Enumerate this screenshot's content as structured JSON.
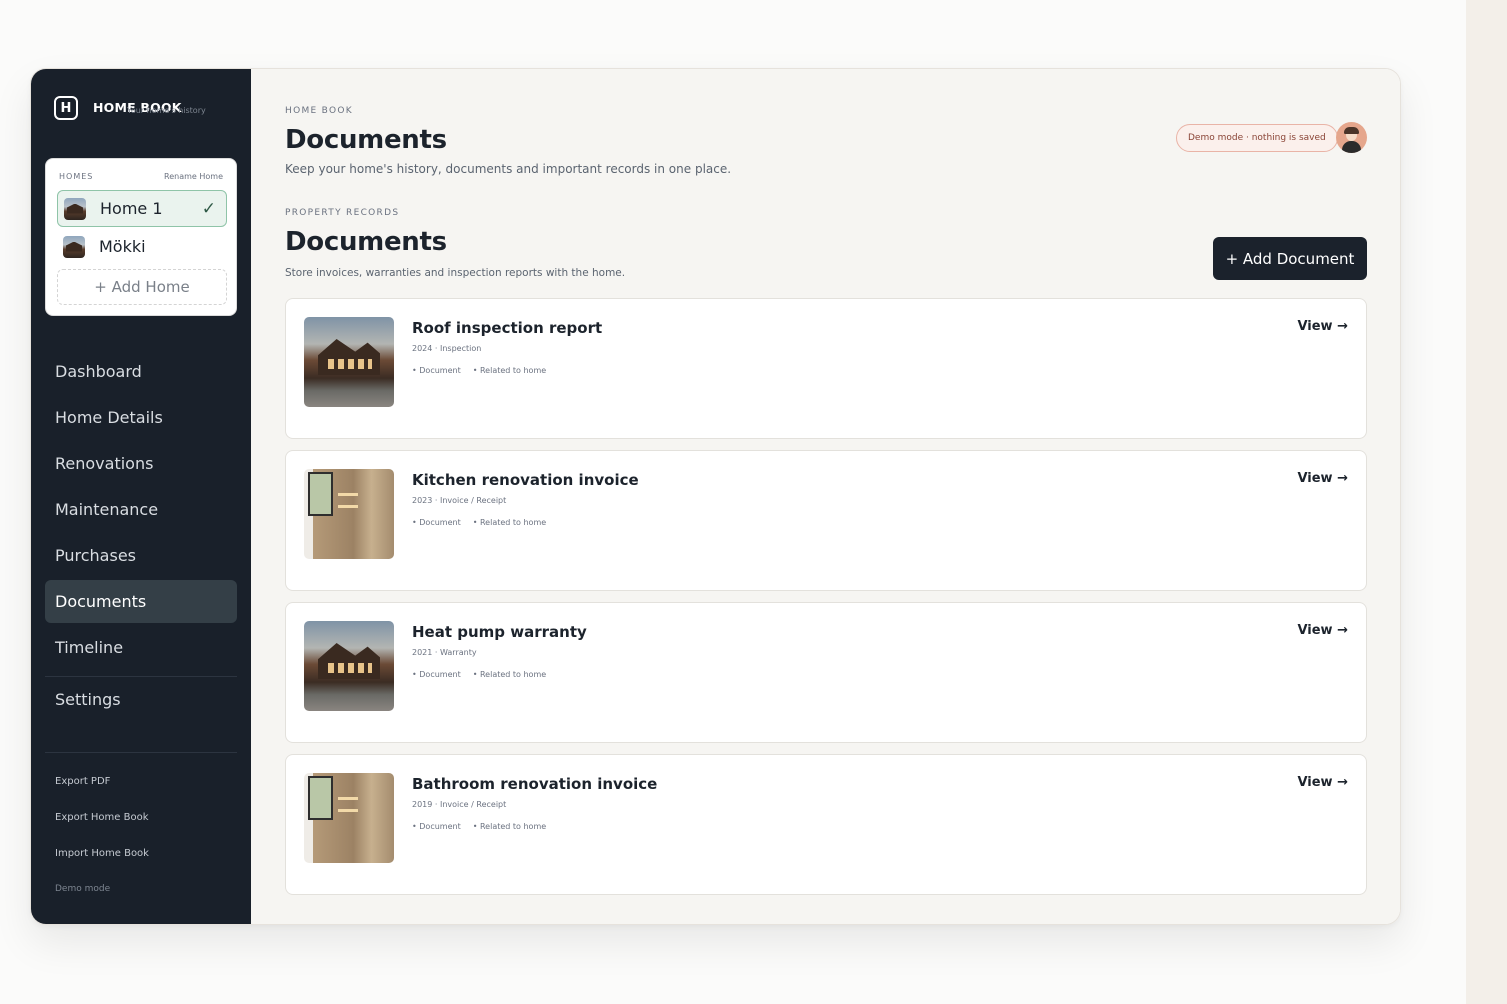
{
  "brand": {
    "name": "HOME BOOK",
    "tagline": "Your home's history",
    "logo_glyph": "H"
  },
  "homes": {
    "label": "HOMES",
    "rename_label": "Rename Home",
    "items": [
      {
        "name": "Home 1",
        "selected": true,
        "check": "✓"
      },
      {
        "name": "Mökki",
        "selected": false
      }
    ],
    "add_label": "+ Add Home"
  },
  "nav": {
    "items": [
      {
        "label": "Dashboard"
      },
      {
        "label": "Home Details"
      },
      {
        "label": "Renovations"
      },
      {
        "label": "Maintenance"
      },
      {
        "label": "Purchases"
      },
      {
        "label": "Documents",
        "active": true
      },
      {
        "label": "Timeline"
      },
      {
        "label": "Settings"
      }
    ]
  },
  "footer": {
    "export_pdf": "Export PDF",
    "export_book": "Export Home Book",
    "import_book": "Import Home Book",
    "demo": "Demo mode"
  },
  "header": {
    "eyebrow": "HOME BOOK",
    "title": "Documents",
    "subtitle": "Keep your home's history, documents and important records in one place.",
    "demo_pill": "Demo mode · nothing is saved"
  },
  "section": {
    "eyebrow": "PROPERTY RECORDS",
    "title": "Documents",
    "subtitle": "Store invoices, warranties and inspection reports with the home.",
    "add_button": "+ Add Document"
  },
  "documents": [
    {
      "title": "Roof inspection report",
      "meta": "2024 · Inspection",
      "tag1": "• Document",
      "tag2": "• Related to home",
      "view": "View →",
      "thumb": "house"
    },
    {
      "title": "Kitchen renovation invoice",
      "meta": "2023 · Invoice / Receipt",
      "tag1": "• Document",
      "tag2": "• Related to home",
      "view": "View →",
      "thumb": "bathroom"
    },
    {
      "title": "Heat pump warranty",
      "meta": "2021 · Warranty",
      "tag1": "• Document",
      "tag2": "• Related to home",
      "view": "View →",
      "thumb": "house"
    },
    {
      "title": "Bathroom renovation invoice",
      "meta": "2019 · Invoice / Receipt",
      "tag1": "• Document",
      "tag2": "• Related to home",
      "view": "View →",
      "thumb": "bathroom"
    }
  ],
  "colors": {
    "sidebar_bg": "#19202a",
    "main_bg": "#f6f5f2",
    "accent_dark": "#1b222c",
    "active_home_bg": "#eaf3ee",
    "demo_pill_border": "#e9b4a7"
  }
}
